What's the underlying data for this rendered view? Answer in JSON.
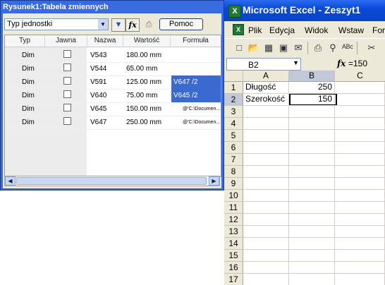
{
  "dialog": {
    "title": "Rysunek1:Tabela zmiennych",
    "type_select_value": "Typ jednostki",
    "toolbar_icons": [
      "filter-icon",
      "fx-icon",
      "print-icon"
    ],
    "fx_label": "fx",
    "help_label": "Pomoc",
    "columns": [
      "Typ",
      "Jawna",
      "Nazwa",
      "Wartość",
      "Formuła"
    ],
    "rows": [
      {
        "typ": "Dim",
        "jawna": false,
        "nazwa": "V543",
        "wartosc": "180.00 mm",
        "formula": ""
      },
      {
        "typ": "Dim",
        "jawna": false,
        "nazwa": "V544",
        "wartosc": "65.00 mm",
        "formula": ""
      },
      {
        "typ": "Dim",
        "jawna": false,
        "nazwa": "V591",
        "wartosc": "125.00 mm",
        "formula": "V647 /2"
      },
      {
        "typ": "Dim",
        "jawna": false,
        "nazwa": "V640",
        "wartosc": "75.00 mm",
        "formula": "V645 /2"
      },
      {
        "typ": "Dim",
        "jawna": false,
        "nazwa": "V645",
        "wartosc": "150.00 mm",
        "formula": "@'C:\\Documen..."
      },
      {
        "typ": "Dim",
        "jawna": false,
        "nazwa": "V647",
        "wartosc": "250.00 mm",
        "formula": "@'C:\\Documen..."
      }
    ]
  },
  "excel": {
    "title": "Microsoft Excel - Zeszyt1",
    "menu": [
      "Plik",
      "Edycja",
      "Widok",
      "Wstaw",
      "Form"
    ],
    "namebox": "B2",
    "formula": "=150",
    "columns": [
      "A",
      "B",
      "C"
    ],
    "rows": [
      "1",
      "2",
      "3",
      "4",
      "5",
      "6",
      "7",
      "8",
      "9",
      "10",
      "11",
      "12",
      "13",
      "14",
      "15",
      "16",
      "17"
    ],
    "cells": {
      "A1": "Długość",
      "B1": "250",
      "A2": "Szerokość",
      "B2": "150"
    },
    "active_cell": "B2"
  }
}
